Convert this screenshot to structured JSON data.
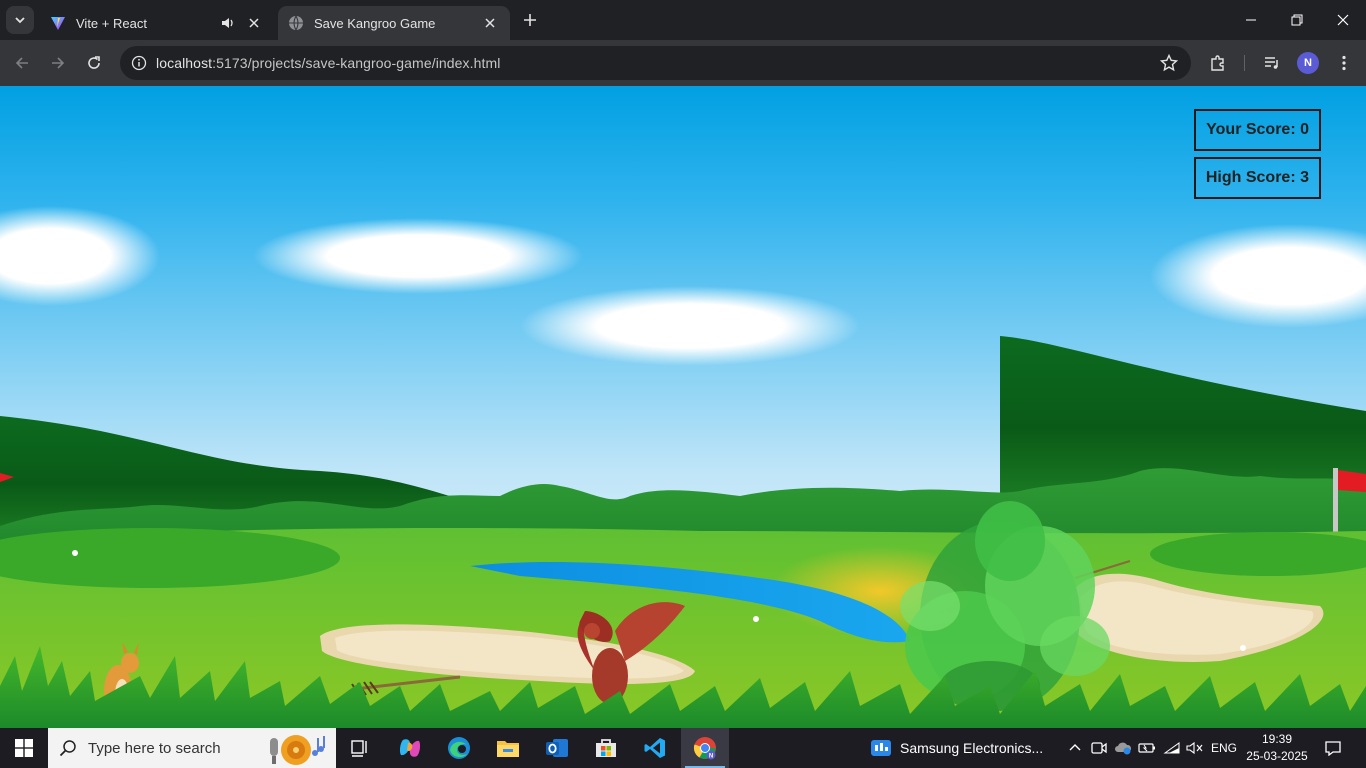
{
  "browser": {
    "tabs": [
      {
        "title": "Vite + React",
        "icon": "vite-icon",
        "audio": true
      },
      {
        "title": "Save Kangroo Game",
        "icon": "globe-icon",
        "active": true
      }
    ],
    "url_host": "localhost",
    "url_path": ":5173/projects/save-kangroo-game/index.html",
    "profile_initial": "N"
  },
  "game": {
    "your_score_label": "Your Score: 0",
    "high_score_label": "High Score: 3",
    "your_score": 0,
    "high_score": 3
  },
  "taskbar": {
    "search_placeholder": "Type here to search",
    "notification_app": "Samsung Electronics...",
    "language": "ENG",
    "time": "19:39",
    "date": "25-03-2025",
    "pinned": [
      "task-view-icon",
      "copilot-icon",
      "edge-icon",
      "file-explorer-icon",
      "outlook-icon",
      "store-icon",
      "vscode-icon",
      "chrome-icon"
    ]
  },
  "colors": {
    "sky_top": "#01a0e2",
    "grass": "#3fae2a",
    "water": "#1a8fe0",
    "sand": "#f1e4c2",
    "flag": "#e31b23"
  }
}
